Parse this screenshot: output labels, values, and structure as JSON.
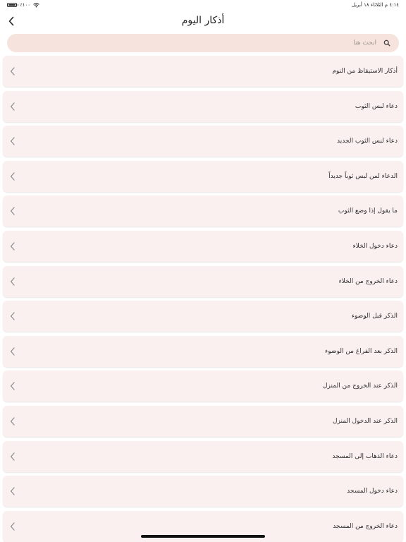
{
  "status_bar": {
    "time_date": "٤:١٤ م   الثلاثاء ١٨ أبريل",
    "battery_percent": "٪١٠٠",
    "battery_level": 1.0
  },
  "header": {
    "title": "أذكار اليوم",
    "back_icon": "chevron-left-icon"
  },
  "search": {
    "placeholder": "ابحث هنا",
    "value": "",
    "icon": "search-icon"
  },
  "list": {
    "chevron_icon": "chevron-left-icon",
    "items": [
      {
        "label": "أذكار الاستيقاظ من النوم"
      },
      {
        "label": "دعاء لبس الثوب"
      },
      {
        "label": "دعاء لبس الثوب الجديد"
      },
      {
        "label": "الدعاء لمن لبس ثوباً جديداً"
      },
      {
        "label": "ما يقول إذا وضع الثوب"
      },
      {
        "label": "دعاء دخول الخلاء"
      },
      {
        "label": "دعاء الخروج من الخلاء"
      },
      {
        "label": "الذكر قبل الوضوء"
      },
      {
        "label": "الذكر بعد الفراغ من الوضوء"
      },
      {
        "label": "الذكر عند الخروج من المنزل"
      },
      {
        "label": "الذكر عند الدخول المنزل"
      },
      {
        "label": "دعاء الذهاب إلى المسجد"
      },
      {
        "label": "دعاء دخول المسجد"
      },
      {
        "label": "دعاء الخروج من المسجد"
      }
    ]
  },
  "colors": {
    "search_background": "#f7e3de",
    "row_background": "#fbf0f0",
    "text": "#2e2e2e"
  }
}
